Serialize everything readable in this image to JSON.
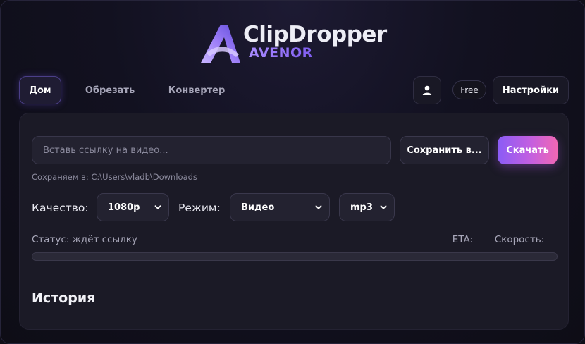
{
  "brand": {
    "name": "ClipDropper",
    "sub": "AVENOR"
  },
  "nav": {
    "items": [
      {
        "label": "Дом",
        "active": true
      },
      {
        "label": "Обрезать",
        "active": false
      },
      {
        "label": "Конвертер",
        "active": false
      }
    ],
    "plan_badge": "Free",
    "settings_label": "Настройки",
    "user_icon": "user-icon"
  },
  "download": {
    "url_value": "",
    "url_placeholder": "Вставь ссылку на видео...",
    "save_label": "Сохранить в...",
    "download_label": "Скачать",
    "save_path": "Сохраняем в: C:\\Users\\vladb\\Downloads"
  },
  "options": {
    "quality_label": "Качество:",
    "quality_value": "1080p",
    "mode_label": "Режим:",
    "mode_value": "Видео",
    "format_value": "mp3"
  },
  "status": {
    "text": "Статус: ждёт ссылку",
    "eta": "ETA: —",
    "speed": "Скорость: —",
    "progress_fraction": 0
  },
  "history": {
    "title": "История"
  },
  "colors": {
    "accent_start": "#8a5cf6",
    "accent_end": "#f067b4",
    "panel": "#1b1a26"
  }
}
